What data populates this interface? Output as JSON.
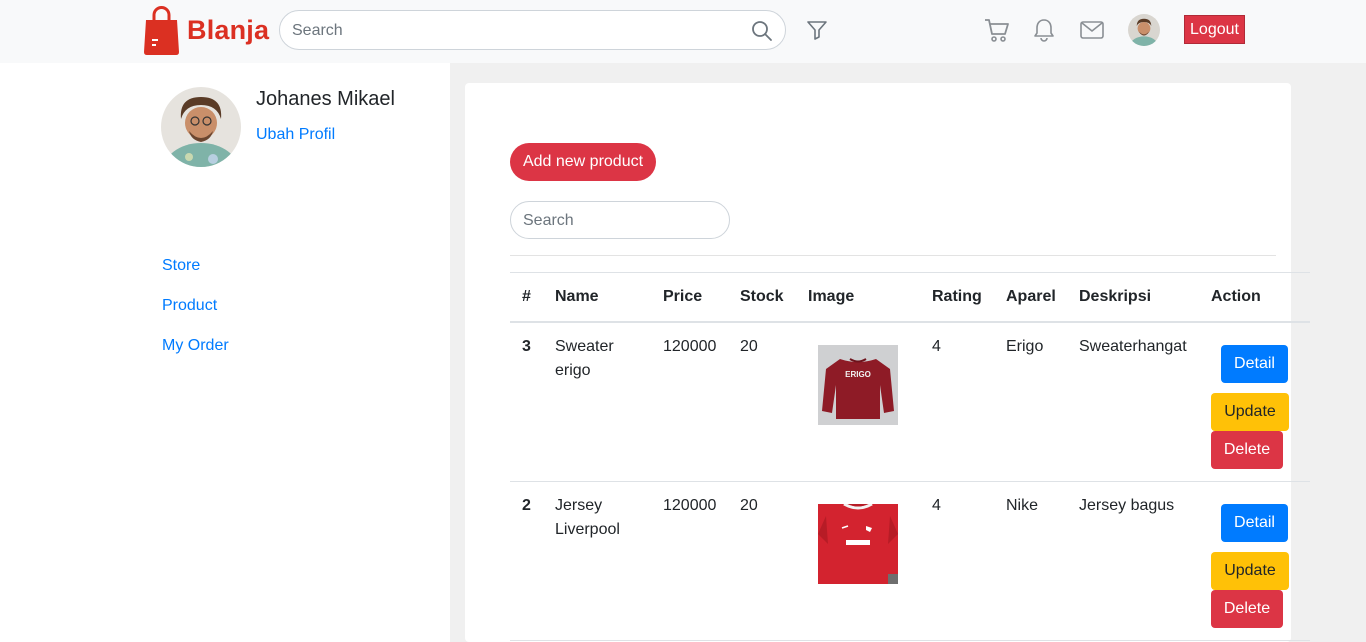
{
  "navbar": {
    "brand": "Blanja",
    "search_placeholder": "Search",
    "logout_label": "Logout"
  },
  "sidebar": {
    "user_name": "Johanes Mikael",
    "edit_profile_label": "Ubah Profil",
    "nav": [
      "Store",
      "Product",
      "My Order"
    ]
  },
  "main": {
    "add_product_label": "Add new product",
    "search_placeholder": "Search",
    "columns": [
      "#",
      "Name",
      "Price",
      "Stock",
      "Image",
      "Rating",
      "Aparel",
      "Deskripsi",
      "Action"
    ],
    "rows": [
      {
        "id": "3",
        "name_line1": "Sweater",
        "name_line2": "erigo",
        "price": "120000",
        "stock": "20",
        "image": "red-sweater-thumbnail",
        "image_text": "ERIGO",
        "rating": "4",
        "aparel": "Erigo",
        "deskripsi": "Sweaterhangat"
      },
      {
        "id": "2",
        "name_line1": "Jersey",
        "name_line2": "Liverpool",
        "price": "120000",
        "stock": "20",
        "image": "red-jersey-thumbnail",
        "rating": "4",
        "aparel": "Nike",
        "deskripsi": "Jersey bagus"
      }
    ],
    "actions": {
      "detail": "Detail",
      "update": "Update",
      "delete": "Delete"
    }
  },
  "colors": {
    "brand": "#db3022",
    "primary": "#007bff",
    "warning": "#ffc107",
    "danger": "#dc3545"
  }
}
